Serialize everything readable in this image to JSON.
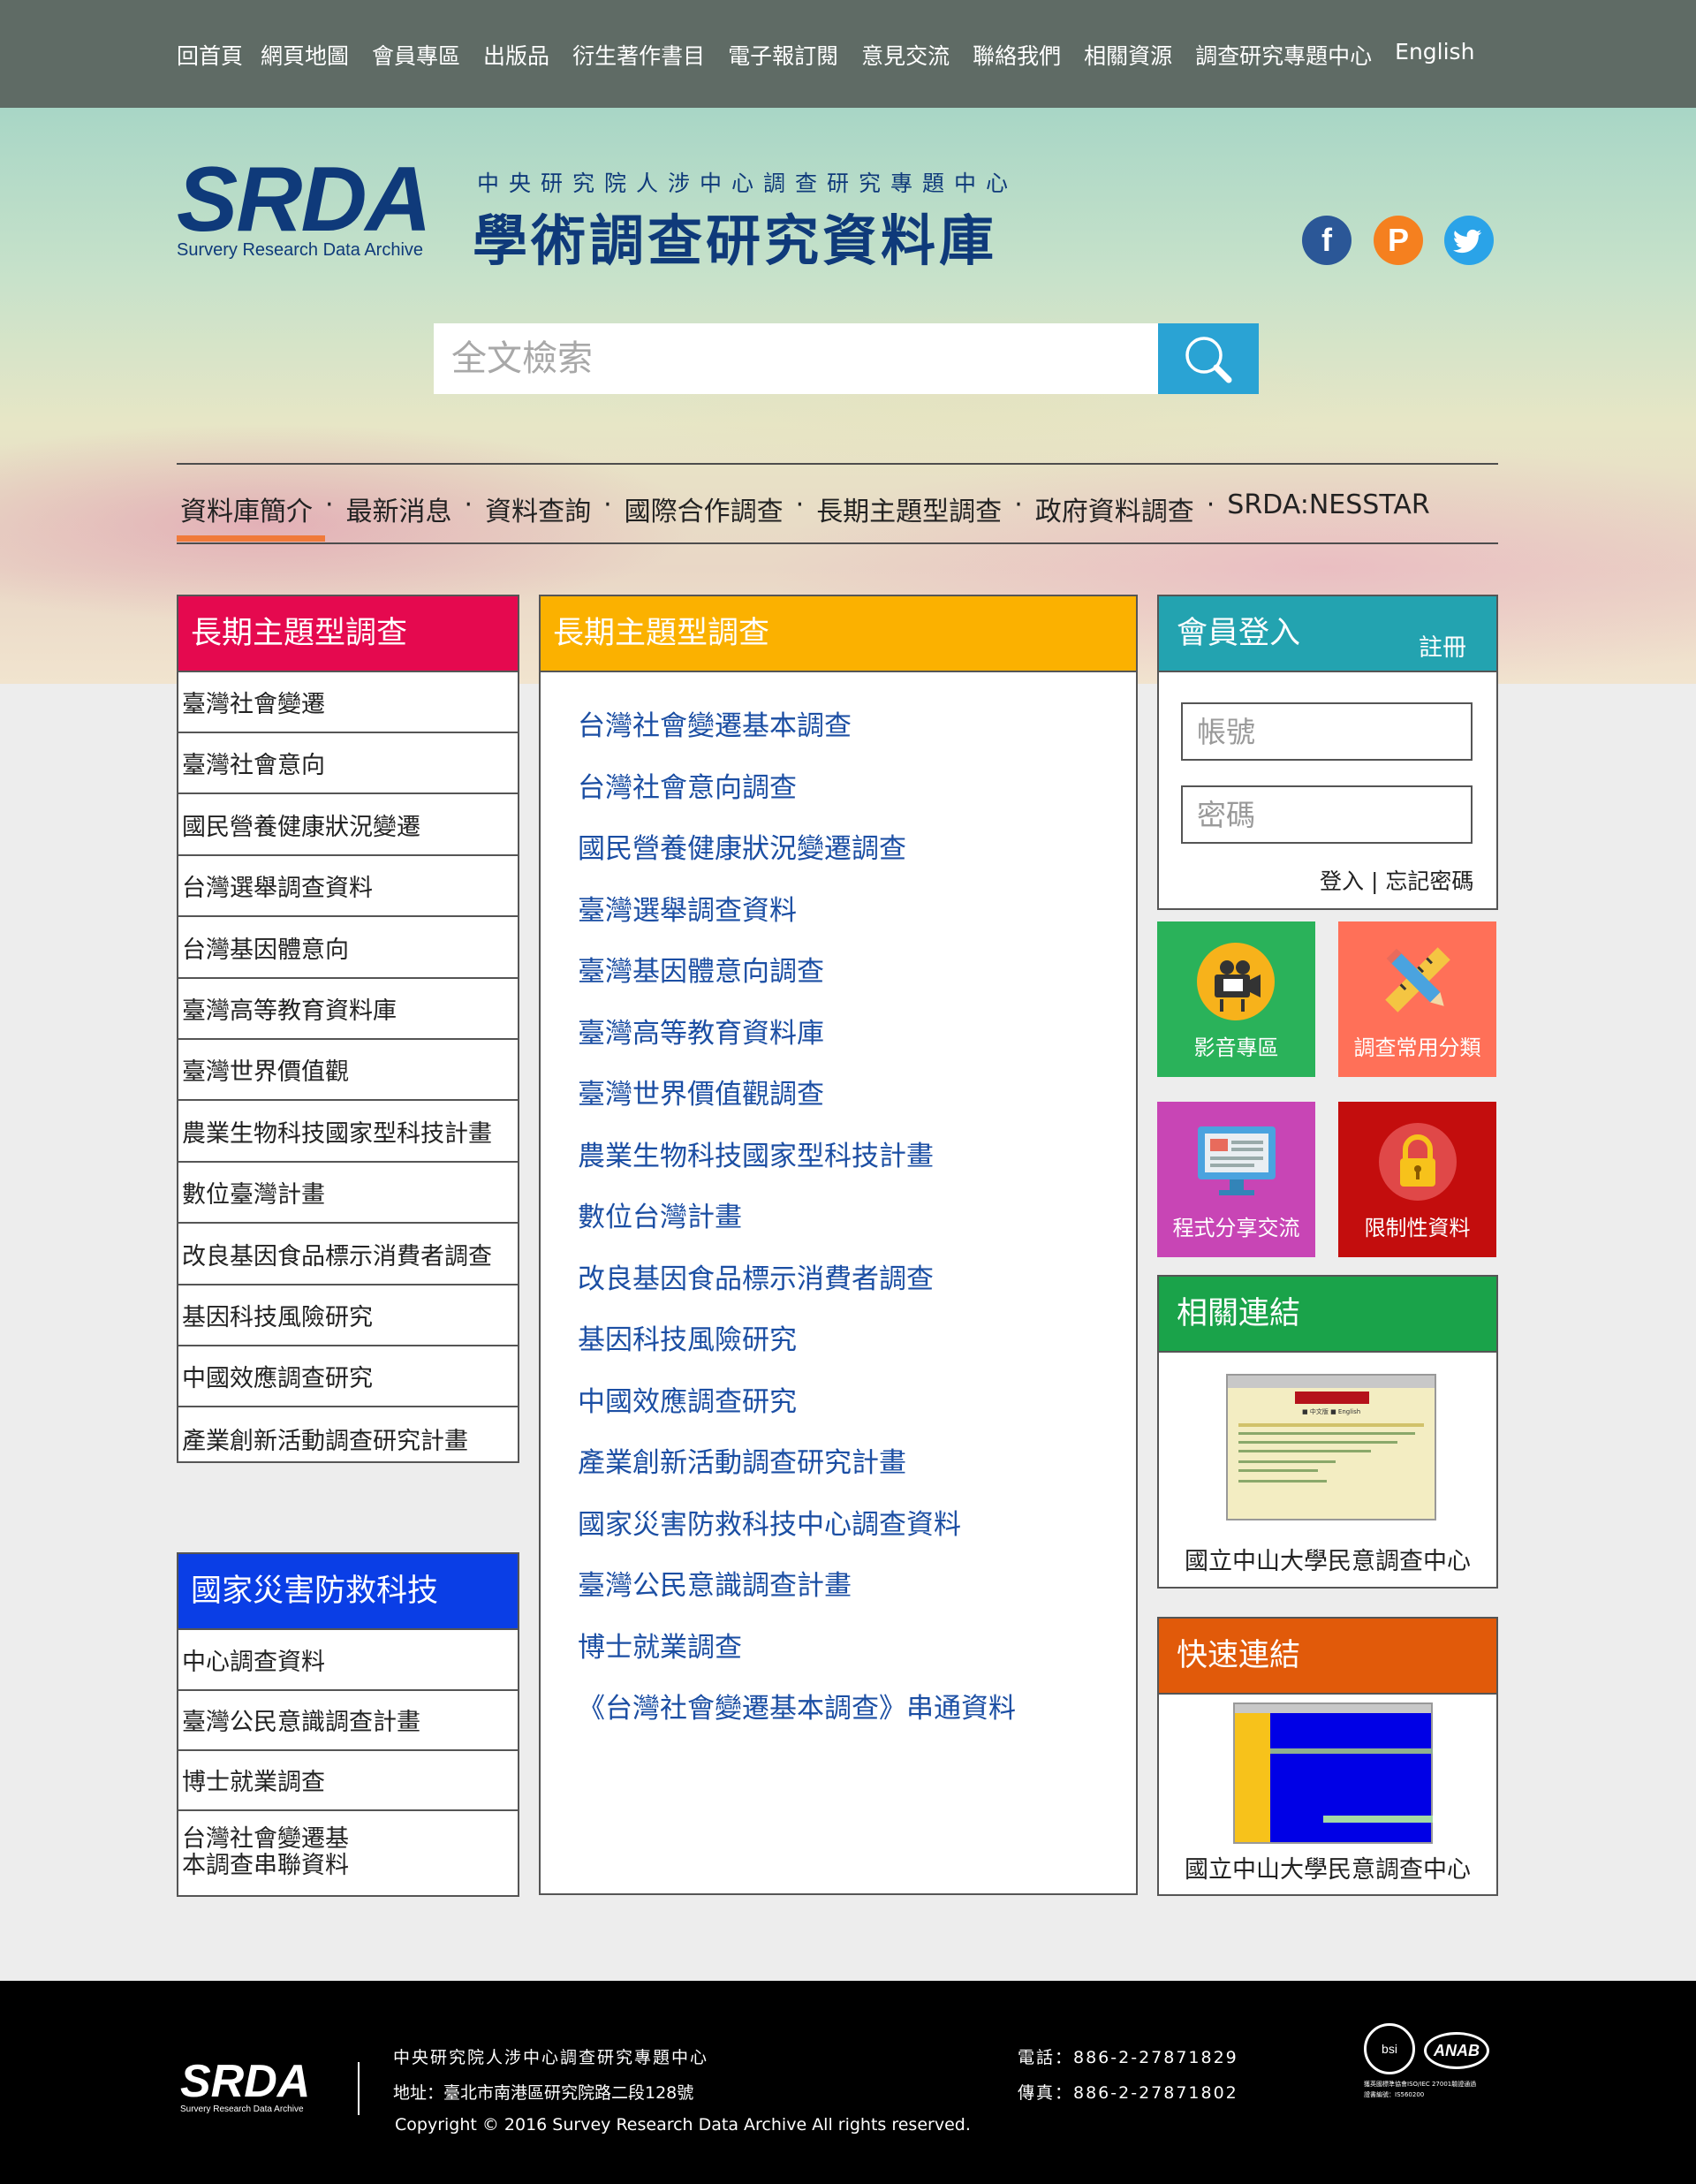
{
  "topnav": [
    "回首頁",
    "網頁地圖",
    "會員專區",
    "出版品",
    "衍生著作書目",
    "電子報訂閱",
    "意見交流",
    "聯絡我們",
    "相關資源",
    "調查研究專題中心",
    "English"
  ],
  "logo": {
    "srda": "SRDA",
    "sub": "Survery Research Data Archive",
    "cn_small": "中央研究院人涉中心調查研究專題中心",
    "cn_big": "學術調查研究資料庫"
  },
  "social": [
    {
      "label": "f",
      "icon": "facebook-icon",
      "color": "#2b5797"
    },
    {
      "label": "P",
      "icon": "plurk-icon",
      "color": "#f5801f"
    },
    {
      "label": "twitter",
      "icon": "twitter-icon",
      "color": "#2aa3e8"
    }
  ],
  "search": {
    "placeholder": "全文檢索",
    "icon": "search-icon"
  },
  "mainnav": [
    "資料庫簡介",
    "最新消息",
    "資料查詢",
    "國際合作調查",
    "長期主題型調查",
    "政府資料調查",
    "SRDA:NESSTAR"
  ],
  "mainnav_sep": "·",
  "left_panel1": {
    "title": "長期主題型調查",
    "color": "#e5094f",
    "items": [
      "臺灣社會變遷",
      "臺灣社會意向",
      "國民營養健康狀況變遷",
      "台灣選舉調查資料",
      "台灣基因體意向",
      "臺灣高等教育資料庫",
      "臺灣世界價值觀",
      "農業生物科技國家型科技計畫",
      "數位臺灣計畫",
      "改良基因食品標示消費者調查",
      "基因科技風險研究",
      "中國效應調查研究",
      "產業創新活動調查研究計畫"
    ]
  },
  "left_panel2": {
    "title": "國家災害防救科技",
    "color": "#0a3ee6",
    "items": [
      "中心調查資料",
      "臺灣公民意識調查計畫",
      "博士就業調查",
      "台灣社會變遷基本調查串聯資料"
    ],
    "last_lines": [
      "台灣社會變遷基",
      "本調查串聯資料"
    ]
  },
  "center_panel": {
    "title": "長期主題型調查",
    "color": "#fbb100",
    "links": [
      "台灣社會變遷基本調查",
      "台灣社會意向調查",
      "國民營養健康狀況變遷調查",
      "臺灣選舉調查資料",
      "臺灣基因體意向調查",
      "臺灣高等教育資料庫",
      "臺灣世界價值觀調查",
      "農業生物科技國家型科技計畫",
      "數位台灣計畫",
      "改良基因食品標示消費者調查",
      "基因科技風險研究",
      "中國效應調查研究",
      "產業創新活動調查研究計畫",
      "國家災害防救科技中心調查資料",
      "臺灣公民意識調查計畫",
      "博士就業調查",
      "《台灣社會變遷基本調查》串通資料"
    ]
  },
  "login": {
    "title": "會員登入",
    "register": "註冊",
    "color": "#23a3b0",
    "account_placeholder": "帳號",
    "password_placeholder": "密碼",
    "login_link": "登入",
    "divider": "|",
    "forgot_link": "忘記密碼"
  },
  "tiles": [
    {
      "label": "影音專區",
      "color": "#2ab25a",
      "icon": "video-camera-icon"
    },
    {
      "label": "調查常用分類",
      "color": "#ff7058",
      "icon": "pencil-ruler-icon"
    },
    {
      "label": "程式分享交流",
      "color": "#c845b5",
      "icon": "monitor-icon"
    },
    {
      "label": "限制性資料",
      "color": "#c30d0d",
      "icon": "lock-icon"
    }
  ],
  "related": {
    "title": "相關連結",
    "color": "#1aa34a",
    "caption": "國立中山大學民意調查中心",
    "thumb_heading": "■ 中文版 ■ English"
  },
  "quick": {
    "title": "快速連結",
    "color": "#e15a0a",
    "caption": "國立中山大學民意調查中心"
  },
  "footer": {
    "srda": "SRDA",
    "sub": "Survery Research Data Archive",
    "org": "中央研究院人涉中心調查研究專題中心",
    "address": "地址：臺北市南港區研究院路二段128號",
    "copyright": "Copyright © 2016 Survey Research Data Archive All rights reserved.",
    "phone": "電話：886-2-27871829",
    "fax": "傳真：886-2-27871802",
    "cert1": "bsi",
    "cert2": "ANAB",
    "cert_note1": "獲英國標準協會ISO/IEC 27001驗證通過",
    "cert_note2": "證書編號：IS560200"
  }
}
